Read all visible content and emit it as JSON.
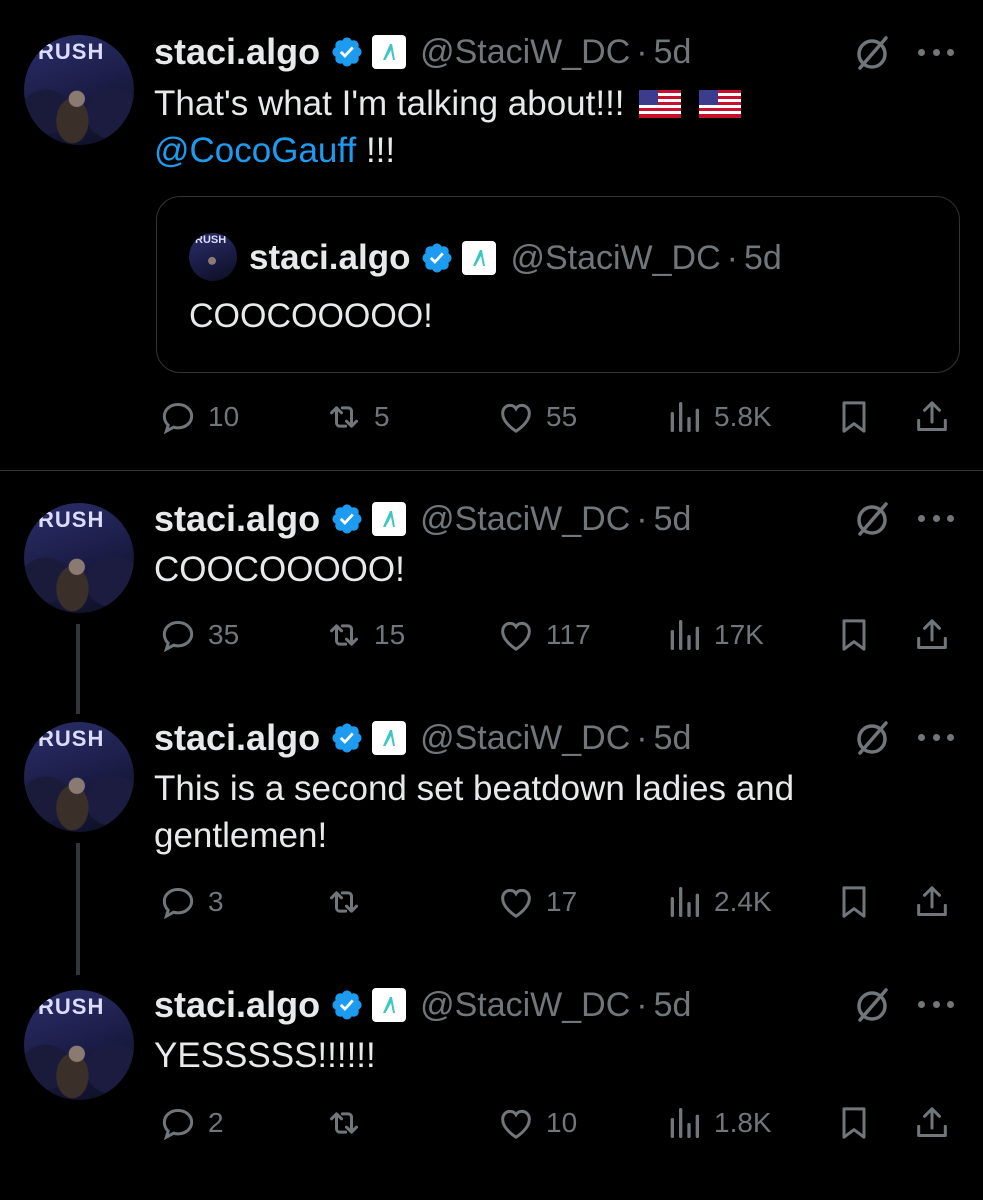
{
  "user": {
    "name": "staci.algo",
    "handle": "@StaciW_DC",
    "separator": "·",
    "avatar_text": "RUSH"
  },
  "colors": {
    "background": "#000000",
    "text": "#e7e9ea",
    "muted": "#71767b",
    "link": "#1d9bf0",
    "verified": "#1d9bf0",
    "algo_badge": "#3ec6c0"
  },
  "tweets": [
    {
      "time": "5d",
      "text_line1": "That's what I'm talking about!!!",
      "mention": "@CocoGauff",
      "text_after_mention": " !!!",
      "flags": [
        "us-flag-icon",
        "us-flag-icon"
      ],
      "quote": {
        "time": "5d",
        "text": "COOCOOOOO!"
      },
      "replies": "10",
      "retweets": "5",
      "likes": "55",
      "views": "5.8K"
    },
    {
      "time": "5d",
      "text": "COOCOOOOO!",
      "replies": "35",
      "retweets": "15",
      "likes": "117",
      "views": "17K"
    },
    {
      "time": "5d",
      "text": "This is a second set beatdown ladies and gentlemen!",
      "replies": "3",
      "retweets": "",
      "likes": "17",
      "views": "2.4K"
    },
    {
      "time": "5d",
      "text": "YESSSSS!!!!!!",
      "replies": "2",
      "retweets": "",
      "likes": "10",
      "views": "1.8K"
    }
  ]
}
